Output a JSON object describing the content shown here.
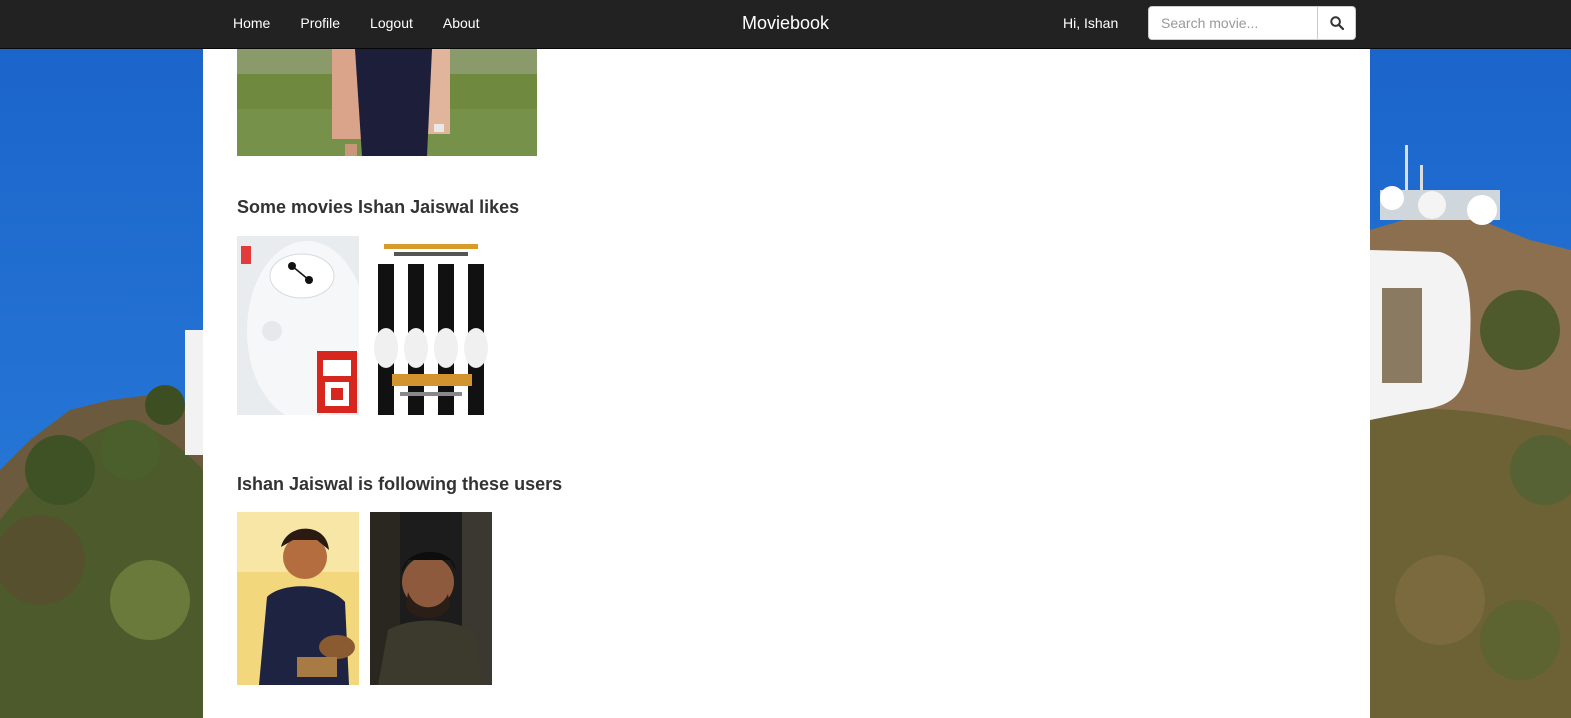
{
  "nav": {
    "links": [
      "Home",
      "Profile",
      "Logout",
      "About"
    ],
    "brand": "Moviebook",
    "greeting": "Hi, Ishan",
    "search_placeholder": "Search movie..."
  },
  "profile": {
    "liked_movies_title": "Some movies Ishan Jaiswal likes",
    "following_title": "Ishan Jaiswal is following these users"
  },
  "liked_movies": [
    "Big Hero 6 poster",
    "Penguins of Madagascar poster"
  ],
  "following_users": [
    "followed user 1",
    "followed user 2"
  ],
  "colors": {
    "navbar": "#222222",
    "sky": "#1f6fd0",
    "heading": "#333333"
  }
}
